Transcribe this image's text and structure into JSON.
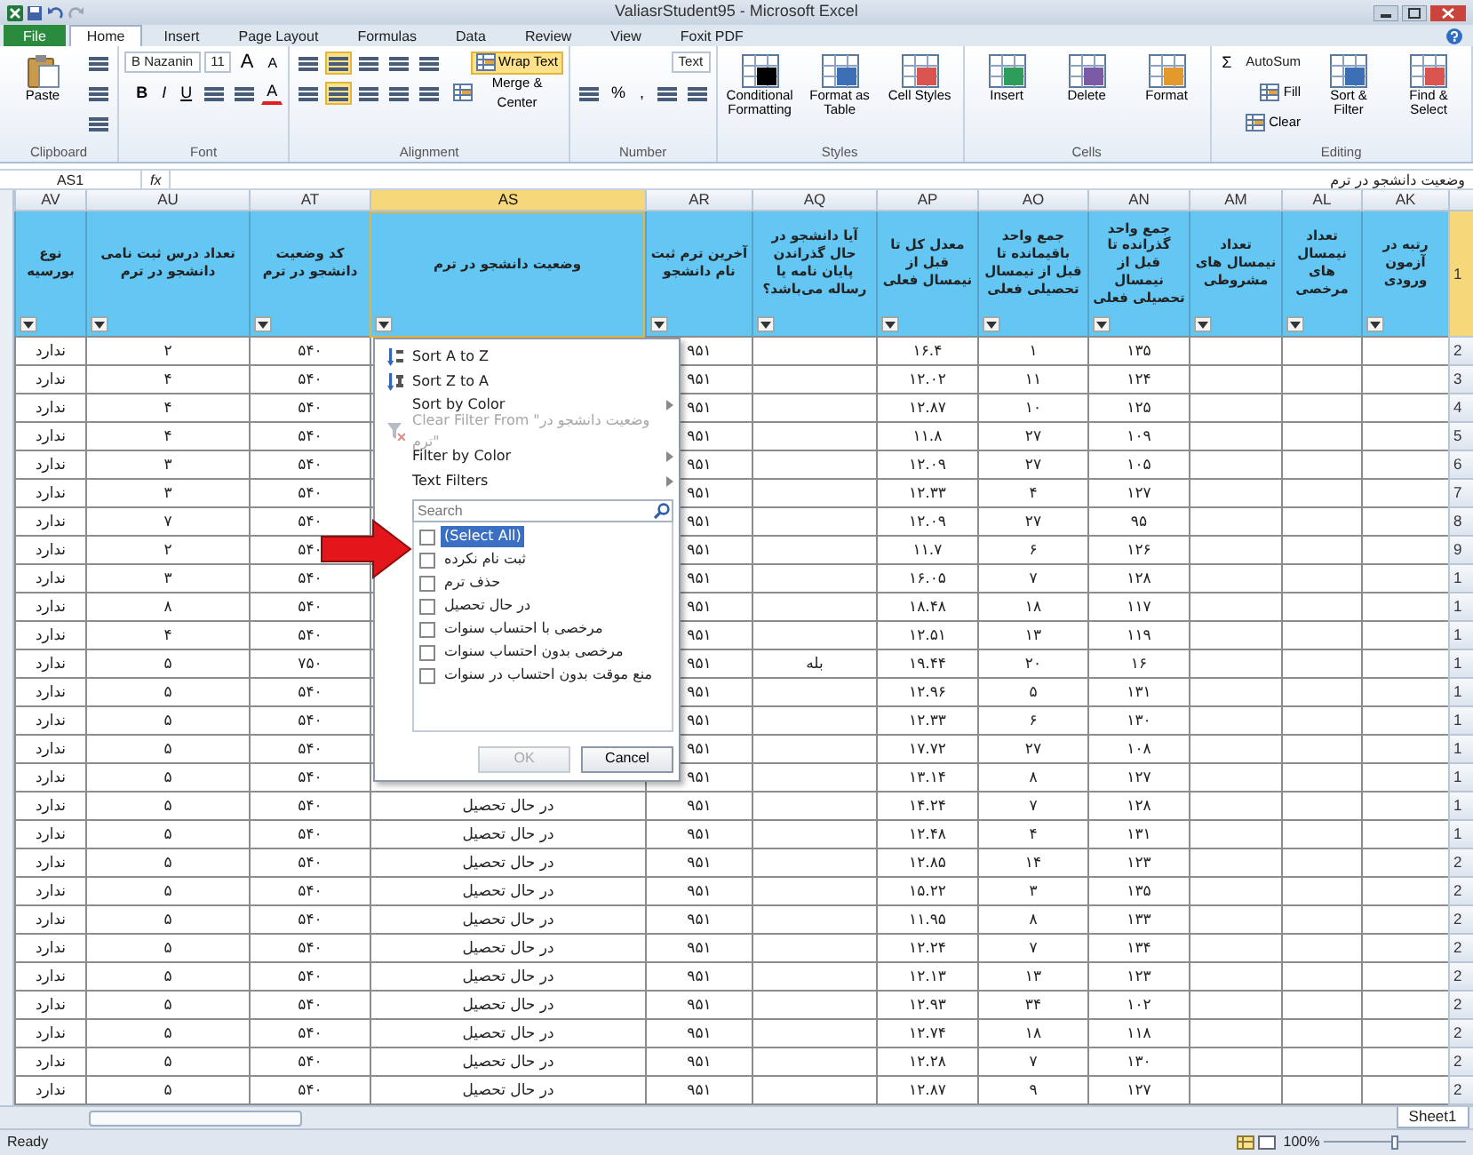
{
  "window": {
    "title": "ValiasrStudent95 - Microsoft Excel"
  },
  "ribbon_tabs": [
    {
      "label": "Foxit PDF",
      "selected": false,
      "kind": "tab"
    },
    {
      "label": "View",
      "selected": false,
      "kind": "tab"
    },
    {
      "label": "Review",
      "selected": false,
      "kind": "tab"
    },
    {
      "label": "Data",
      "selected": false,
      "kind": "tab"
    },
    {
      "label": "Formulas",
      "selected": false,
      "kind": "tab"
    },
    {
      "label": "Page Layout",
      "selected": false,
      "kind": "tab"
    },
    {
      "label": "Insert",
      "selected": false,
      "kind": "tab"
    },
    {
      "label": "Home",
      "selected": true,
      "kind": "tab"
    },
    {
      "label": "File",
      "selected": false,
      "kind": "file"
    }
  ],
  "ribbon_groups": [
    {
      "label": "Editing",
      "items": [
        {
          "kind": "large",
          "label": "Find & Select"
        },
        {
          "kind": "large",
          "label": "Sort & Filter"
        },
        {
          "kind": "rows",
          "rows": [
            [
              {
                "kind": "text",
                "label": "AutoSum"
              },
              {
                "kind": "glyph",
                "label": "Σ"
              }
            ],
            [
              {
                "kind": "button",
                "label": "Fill",
                "on": false
              }
            ],
            [
              {
                "kind": "button",
                "label": "Clear",
                "on": false
              }
            ]
          ]
        }
      ]
    },
    {
      "label": "Cells",
      "items": [
        {
          "kind": "large",
          "label": "Format"
        },
        {
          "kind": "large",
          "label": "Delete"
        },
        {
          "kind": "large",
          "label": "Insert"
        }
      ]
    },
    {
      "label": "Styles",
      "items": [
        {
          "kind": "large",
          "label": "Cell Styles"
        },
        {
          "kind": "large",
          "label": "Format as Table"
        },
        {
          "kind": "large",
          "label": "Conditional Formatting"
        }
      ]
    },
    {
      "label": "Number",
      "items": [
        {
          "kind": "rows",
          "rows": [
            [
              {
                "kind": "field",
                "value": "Text"
              }
            ],
            [
              {
                "kind": "icon",
                "on": false
              },
              {
                "kind": "icon",
                "on": false
              },
              {
                "kind": "glyph",
                "label": ","
              },
              {
                "kind": "glyph",
                "label": "%"
              },
              {
                "kind": "icon",
                "on": false
              }
            ]
          ]
        }
      ]
    },
    {
      "label": "Alignment",
      "items": [
        {
          "kind": "rows",
          "rows": [
            [
              {
                "kind": "button",
                "label": "Wrap Text",
                "on": true
              }
            ],
            [
              {
                "kind": "button",
                "label": "Merge & Center",
                "on": false
              }
            ]
          ]
        },
        {
          "kind": "rows",
          "rows": [
            [
              {
                "kind": "icon",
                "on": false
              },
              {
                "kind": "icon",
                "on": false
              },
              {
                "kind": "icon",
                "on": false
              },
              {
                "kind": "icon",
                "on": true
              },
              {
                "kind": "icon",
                "on": false
              }
            ],
            [
              {
                "kind": "icon",
                "on": false
              },
              {
                "kind": "icon",
                "on": false
              },
              {
                "kind": "icon",
                "on": false
              },
              {
                "kind": "icon",
                "on": true
              },
              {
                "kind": "icon",
                "on": false
              }
            ]
          ]
        }
      ]
    },
    {
      "label": "Font",
      "items": [
        {
          "kind": "rows",
          "rows": [
            [
              {
                "kind": "shrink",
                "label": "A"
              },
              {
                "kind": "grow",
                "label": "A"
              },
              {
                "kind": "field",
                "value": "11"
              },
              {
                "kind": "field",
                "value": "B Nazanin"
              }
            ],
            [
              {
                "kind": "font_color",
                "label": "A"
              },
              {
                "kind": "icon",
                "on": false
              },
              {
                "kind": "icon",
                "on": false
              },
              {
                "kind": "underline",
                "label": "U"
              },
              {
                "kind": "italic",
                "label": "I"
              },
              {
                "kind": "bold",
                "label": "B"
              }
            ]
          ]
        }
      ]
    },
    {
      "label": "Clipboard",
      "items": [
        {
          "kind": "rows",
          "rows": [
            [
              {
                "kind": "icon",
                "on": false
              }
            ],
            [
              {
                "kind": "icon",
                "on": false
              }
            ],
            [
              {
                "kind": "icon",
                "on": false
              }
            ]
          ]
        },
        {
          "kind": "large",
          "label": "Paste"
        }
      ]
    }
  ],
  "formula_bar": {
    "name_box": "AS1",
    "fx": "fx",
    "content": "وضعیت دانشجو در ترم"
  },
  "columns": [
    {
      "letter": "AK",
      "header": "رتبه در آزمون ورودی",
      "selected": false
    },
    {
      "letter": "AL",
      "header": "تعداد نیمسال های مرخصی",
      "selected": false
    },
    {
      "letter": "AM",
      "header": "تعداد نیمسال های مشروطی",
      "selected": false
    },
    {
      "letter": "AN",
      "header": "جمع واحد گذرانده تا قبل از نیمسال تحصیلی فعلی",
      "selected": false
    },
    {
      "letter": "AO",
      "header": "جمع واحد باقیمانده تا قبل از نیمسال تحصیلی فعلی",
      "selected": false
    },
    {
      "letter": "AP",
      "header": "معدل کل تا قبل از نیمسال فعلی",
      "selected": false
    },
    {
      "letter": "AQ",
      "header": "آیا دانشجو در حال گذراندن پایان نامه یا رساله می‌باشد؟",
      "selected": false
    },
    {
      "letter": "AR",
      "header": "آخرین ترم ثبت نام دانشجو",
      "selected": false
    },
    {
      "letter": "AS",
      "header": "وضعیت دانشجو در ترم",
      "selected": true
    },
    {
      "letter": "AT",
      "header": "کد وضعیت دانشجو در ترم",
      "selected": false
    },
    {
      "letter": "AU",
      "header": "تعداد درس ثبت نامی دانشجو در ترم",
      "selected": false
    },
    {
      "letter": "AV",
      "header": "نوع بورسیه",
      "selected": false
    }
  ],
  "header_row_number": "1",
  "rows": [
    {
      "number": "2",
      "cells": [
        null,
        null,
        null,
        "۱۳۵",
        "۱",
        "۱۶.۴",
        null,
        "۹۵۱",
        null,
        "۵۴۰",
        "۲",
        "ندارد"
      ]
    },
    {
      "number": "3",
      "cells": [
        null,
        null,
        null,
        "۱۲۴",
        "۱۱",
        "۱۲.۰۲",
        null,
        "۹۵۱",
        null,
        "۵۴۰",
        "۴",
        "ندارد"
      ]
    },
    {
      "number": "4",
      "cells": [
        null,
        null,
        null,
        "۱۲۵",
        "۱۰",
        "۱۲.۸۷",
        null,
        "۹۵۱",
        null,
        "۵۴۰",
        "۴",
        "ندارد"
      ]
    },
    {
      "number": "5",
      "cells": [
        null,
        null,
        null,
        "۱۰۹",
        "۲۷",
        "۱۱.۸",
        null,
        "۹۵۱",
        null,
        "۵۴۰",
        "۴",
        "ندارد"
      ]
    },
    {
      "number": "6",
      "cells": [
        null,
        null,
        null,
        "۱۰۵",
        "۲۷",
        "۱۲.۰۹",
        null,
        "۹۵۱",
        null,
        "۵۴۰",
        "۳",
        "ندارد"
      ]
    },
    {
      "number": "7",
      "cells": [
        null,
        null,
        null,
        "۱۲۷",
        "۴",
        "۱۲.۳۳",
        null,
        "۹۵۱",
        null,
        "۵۴۰",
        "۳",
        "ندارد"
      ]
    },
    {
      "number": "8",
      "cells": [
        null,
        null,
        null,
        "۹۵",
        "۲۷",
        "۱۲.۰۹",
        null,
        "۹۵۱",
        null,
        "۵۴۰",
        "۷",
        "ندارد"
      ]
    },
    {
      "number": "9",
      "cells": [
        null,
        null,
        null,
        "۱۲۶",
        "۶",
        "۱۱.۷",
        null,
        "۹۵۱",
        null,
        "۵۴۰",
        "۲",
        "ندارد"
      ]
    },
    {
      "number": "1",
      "cells": [
        null,
        null,
        null,
        "۱۲۸",
        "۷",
        "۱۶.۰۵",
        null,
        "۹۵۱",
        null,
        "۵۴۰",
        "۳",
        "ندارد"
      ]
    },
    {
      "number": "1",
      "cells": [
        null,
        null,
        null,
        "۱۱۷",
        "۱۸",
        "۱۸.۴۸",
        null,
        "۹۵۱",
        null,
        "۵۴۰",
        "۸",
        "ندارد"
      ]
    },
    {
      "number": "1",
      "cells": [
        null,
        null,
        null,
        "۱۱۹",
        "۱۳",
        "۱۲.۵۱",
        null,
        "۹۵۱",
        null,
        "۵۴۰",
        "۴",
        "ندارد"
      ]
    },
    {
      "number": "1",
      "cells": [
        null,
        null,
        null,
        "۱۶",
        "۲۰",
        "۱۹.۴۴",
        "بله",
        "۹۵۱",
        null,
        "۷۵۰",
        "۵",
        "ندارد"
      ]
    },
    {
      "number": "1",
      "cells": [
        null,
        null,
        null,
        "۱۳۱",
        "۵",
        "۱۲.۹۶",
        null,
        "۹۵۱",
        null,
        "۵۴۰",
        "۵",
        "ندارد"
      ]
    },
    {
      "number": "1",
      "cells": [
        null,
        null,
        null,
        "۱۳۰",
        "۶",
        "۱۲.۳۳",
        null,
        "۹۵۱",
        null,
        "۵۴۰",
        "۵",
        "ندارد"
      ]
    },
    {
      "number": "1",
      "cells": [
        null,
        null,
        null,
        "۱۰۸",
        "۲۷",
        "۱۷.۷۲",
        null,
        "۹۵۱",
        null,
        "۵۴۰",
        "۵",
        "ندارد"
      ]
    },
    {
      "number": "1",
      "cells": [
        null,
        null,
        null,
        "۱۲۷",
        "۸",
        "۱۳.۱۴",
        null,
        "۹۵۱",
        null,
        "۵۴۰",
        "۵",
        "ندارد"
      ]
    },
    {
      "number": "1",
      "cells": [
        null,
        null,
        null,
        "۱۲۸",
        "۷",
        "۱۴.۲۴",
        null,
        "۹۵۱",
        "در حال تحصیل",
        "۵۴۰",
        "۵",
        "ندارد"
      ]
    },
    {
      "number": "1",
      "cells": [
        null,
        null,
        null,
        "۱۳۱",
        "۴",
        "۱۲.۴۸",
        null,
        "۹۵۱",
        "در حال تحصیل",
        "۵۴۰",
        "۵",
        "ندارد"
      ]
    },
    {
      "number": "2",
      "cells": [
        null,
        null,
        null,
        "۱۲۳",
        "۱۴",
        "۱۲.۸۵",
        null,
        "۹۵۱",
        "در حال تحصیل",
        "۵۴۰",
        "۵",
        "ندارد"
      ]
    },
    {
      "number": "2",
      "cells": [
        null,
        null,
        null,
        "۱۳۵",
        "۳",
        "۱۵.۲۲",
        null,
        "۹۵۱",
        "در حال تحصیل",
        "۵۴۰",
        "۵",
        "ندارد"
      ]
    },
    {
      "number": "2",
      "cells": [
        null,
        null,
        null,
        "۱۳۳",
        "۸",
        "۱۱.۹۵",
        null,
        "۹۵۱",
        "در حال تحصیل",
        "۵۴۰",
        "۵",
        "ندارد"
      ]
    },
    {
      "number": "2",
      "cells": [
        null,
        null,
        null,
        "۱۳۴",
        "۷",
        "۱۲.۲۴",
        null,
        "۹۵۱",
        "در حال تحصیل",
        "۵۴۰",
        "۵",
        "ندارد"
      ]
    },
    {
      "number": "2",
      "cells": [
        null,
        null,
        null,
        "۱۲۳",
        "۱۳",
        "۱۲.۱۳",
        null,
        "۹۵۱",
        "در حال تحصیل",
        "۵۴۰",
        "۵",
        "ندارد"
      ]
    },
    {
      "number": "2",
      "cells": [
        null,
        null,
        null,
        "۱۰۲",
        "۳۴",
        "۱۲.۹۳",
        null,
        "۹۵۱",
        "در حال تحصیل",
        "۵۴۰",
        "۵",
        "ندارد"
      ]
    },
    {
      "number": "2",
      "cells": [
        null,
        null,
        null,
        "۱۱۸",
        "۱۸",
        "۱۲.۷۴",
        null,
        "۹۵۱",
        "در حال تحصیل",
        "۵۴۰",
        "۵",
        "ندارد"
      ]
    },
    {
      "number": "2",
      "cells": [
        null,
        null,
        null,
        "۱۳۰",
        "۷",
        "۱۲.۲۸",
        null,
        "۹۵۱",
        "در حال تحصیل",
        "۵۴۰",
        "۵",
        "ندارد"
      ]
    },
    {
      "number": "2",
      "cells": [
        null,
        null,
        null,
        "۱۲۷",
        "۹",
        "۱۲.۸۷",
        null,
        "۹۵۱",
        "در حال تحصیل",
        "۵۴۰",
        "۵",
        "ندارد"
      ]
    }
  ],
  "filter_menu": {
    "items": [
      {
        "kind": "sort_asc",
        "label": "Sort A to Z",
        "disabled": false,
        "submenu": false
      },
      {
        "kind": "sort_desc",
        "label": "Sort Z to A",
        "disabled": false,
        "submenu": false
      },
      {
        "kind": "plain",
        "label": "Sort by Color",
        "disabled": false,
        "submenu": true
      },
      {
        "kind": "clear",
        "label": "Clear Filter From \"وضعیت دانشجو در ترم\"",
        "disabled": true,
        "submenu": false
      },
      {
        "kind": "plain",
        "label": "Filter by Color",
        "disabled": false,
        "submenu": true
      },
      {
        "kind": "plain",
        "label": "Text Filters",
        "disabled": false,
        "submenu": true
      }
    ],
    "search": {
      "placeholder": "Search"
    },
    "values": [
      {
        "label": "(Select All)",
        "checked": false,
        "selected": true
      },
      {
        "label": "ثبت نام نکرده",
        "checked": false,
        "selected": false
      },
      {
        "label": "حذف ترم",
        "checked": false,
        "selected": false
      },
      {
        "label": "در حال تحصیل",
        "checked": false,
        "selected": false
      },
      {
        "label": "مرخصی با احتساب سنوات",
        "checked": false,
        "selected": false
      },
      {
        "label": "مرخصی بدون احتساب سنوات",
        "checked": false,
        "selected": false
      },
      {
        "label": "منع موقت بدون احتساب در سنوات",
        "checked": false,
        "selected": false
      }
    ],
    "buttons": [
      {
        "label": "Cancel",
        "disabled": false
      },
      {
        "label": "OK",
        "disabled": true
      }
    ]
  },
  "sheet_tabs": [
    {
      "label": "Sheet1",
      "selected": true
    }
  ],
  "status_bar": {
    "status": "Ready",
    "zoom": "100%",
    "zoom_slider": {
      "level": 0.5
    }
  }
}
